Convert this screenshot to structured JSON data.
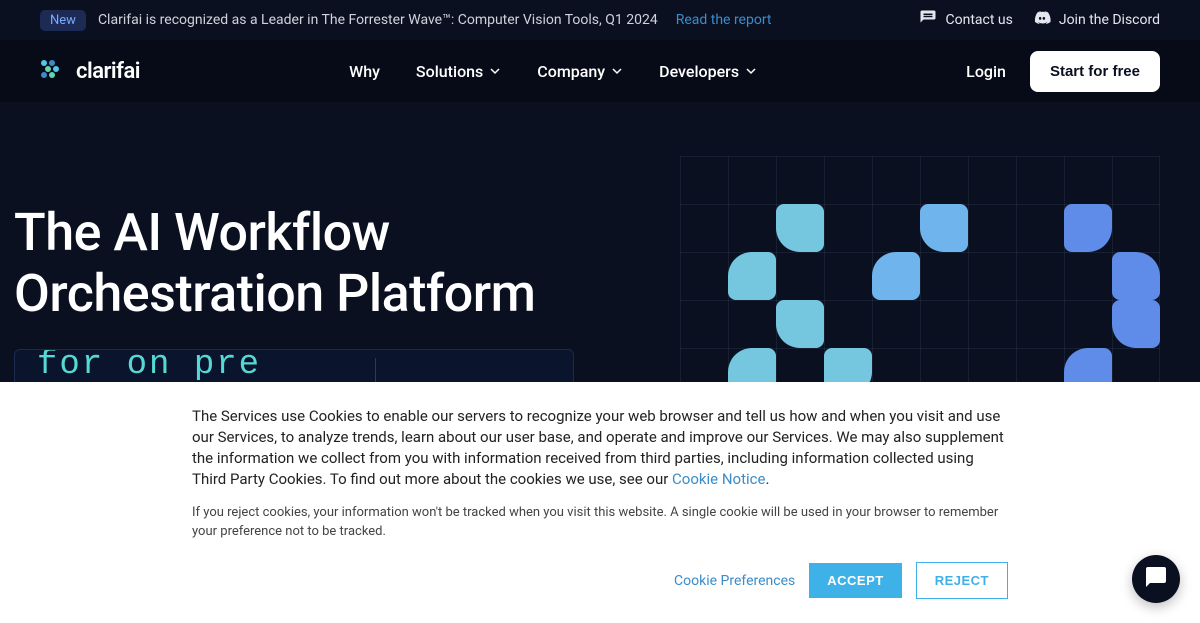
{
  "announce": {
    "badge": "New",
    "text": "Clarifai is recognized as a Leader in The Forrester Wave™: Computer Vision Tools, Q1 2024",
    "cta": "Read the report",
    "contact": "Contact us",
    "discord": "Join the Discord"
  },
  "nav": {
    "brand": "clarifai",
    "items": [
      "Why",
      "Solutions",
      "Company",
      "Developers"
    ],
    "login": "Login",
    "cta": "Start for free"
  },
  "hero": {
    "title_l1": "The AI Workflow",
    "title_l2": "Orchestration Platform"
  },
  "cookies": {
    "body_prefix": "The Services use Cookies to enable our servers to recognize your web browser and tell us how and when you visit and use our Services, to analyze trends, learn about our user base, and operate and improve our Services. We may also supplement the information we collect from you with information received from third parties, including information collected using Third Party Cookies. To find out more about the cookies we use, see our ",
    "link_label": "Cookie Notice",
    "body_suffix": ".",
    "note": "If you reject cookies, your information won't be tracked when you visit this website. A single cookie will be used in your browser to remember your preference not to be tracked.",
    "pref": "Cookie Preferences",
    "accept": "ACCEPT",
    "reject": "REJECT"
  }
}
